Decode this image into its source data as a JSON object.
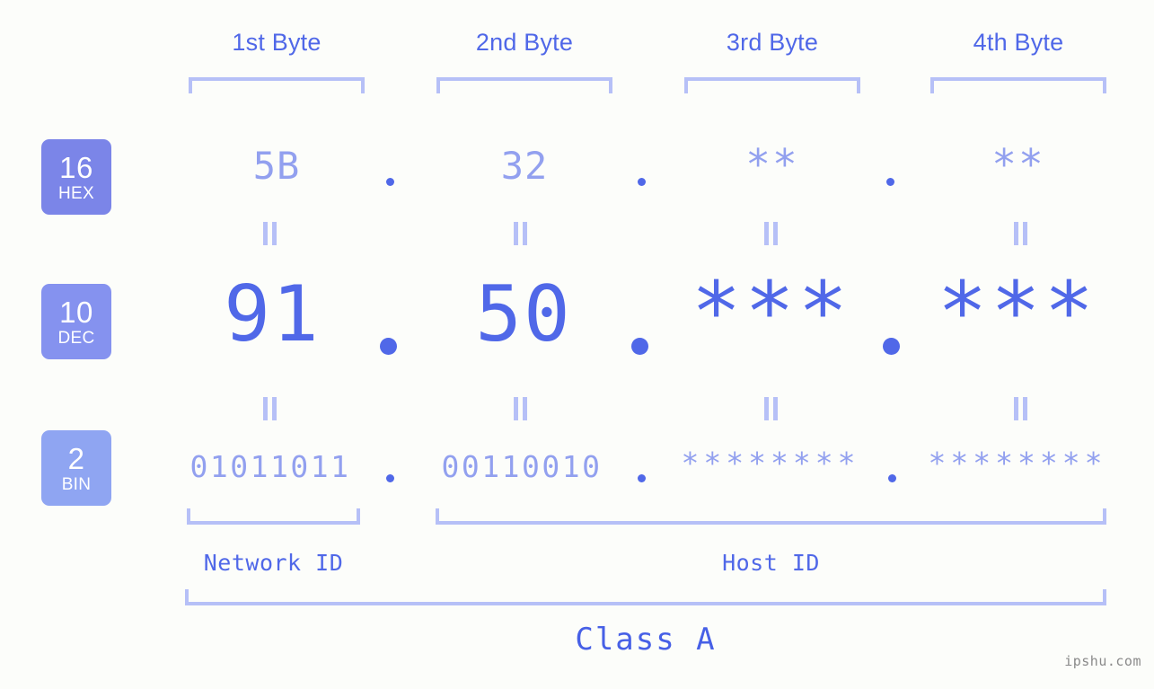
{
  "background_color": "#fcfdfa",
  "accent_colors": {
    "strong": "#5068e8",
    "light": "#92a0ef",
    "bracket": "#b6c0f7",
    "badge_hex": "#7b85e8",
    "badge_dec": "#8592ef",
    "badge_bin": "#8fa5f2",
    "watermark": "#8a8a8a"
  },
  "byte_headers": [
    {
      "label": "1st Byte"
    },
    {
      "label": "2nd Byte"
    },
    {
      "label": "3rd Byte"
    },
    {
      "label": "4th Byte"
    }
  ],
  "bases": [
    {
      "num": "16",
      "name": "HEX"
    },
    {
      "num": "10",
      "name": "DEC"
    },
    {
      "num": "2",
      "name": "BIN"
    }
  ],
  "rows": {
    "hex": {
      "base_num": "16",
      "base_name": "HEX",
      "values": [
        "5B",
        "32",
        "**",
        "**"
      ],
      "separator": "."
    },
    "dec": {
      "base_num": "10",
      "base_name": "DEC",
      "values": [
        "91",
        "50",
        "***",
        "***"
      ],
      "separator": "."
    },
    "bin": {
      "base_num": "2",
      "base_name": "BIN",
      "values": [
        "01011011",
        "00110010",
        "********",
        "********"
      ],
      "separator": "."
    }
  },
  "equals_sign": "=",
  "footer": {
    "network_id_label": "Network ID",
    "host_id_label": "Host ID",
    "class_label": "Class A"
  },
  "watermark": "ipshu.com"
}
